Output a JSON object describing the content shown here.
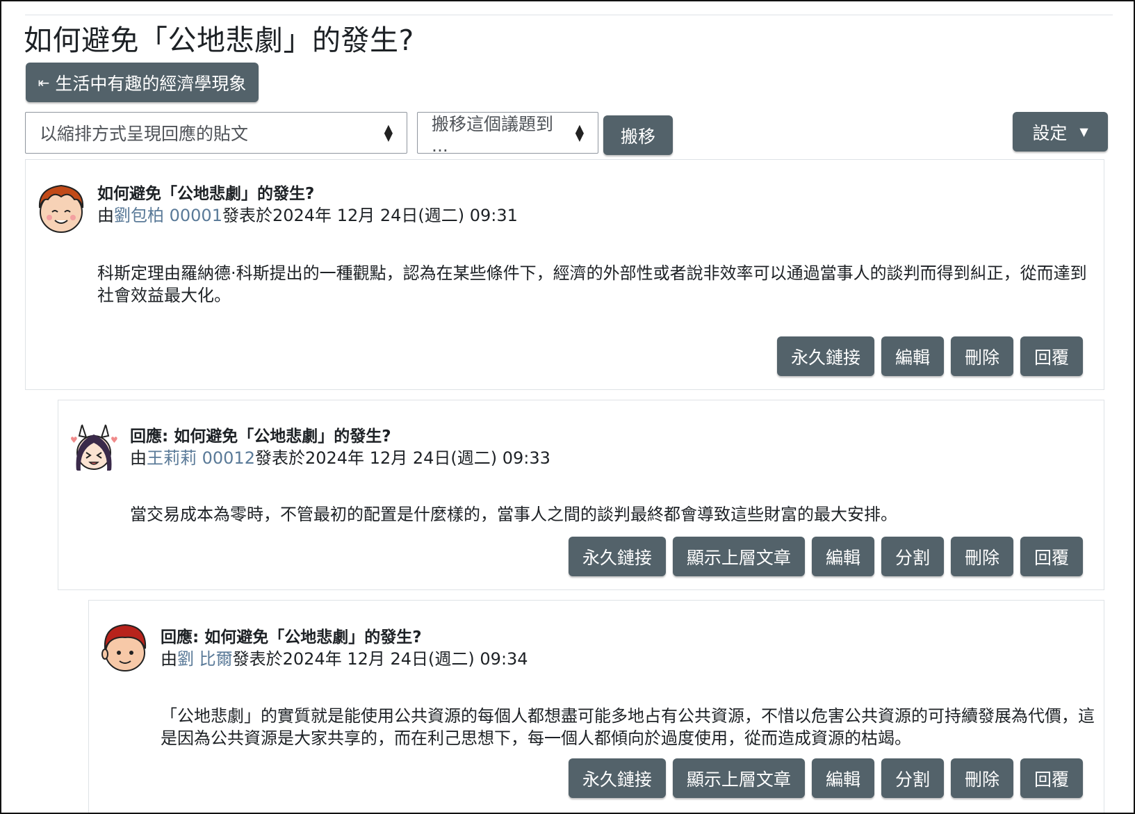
{
  "page": {
    "title": "如何避免「公地悲劇」的發生?",
    "back_link": "生活中有趣的經濟學現象",
    "display_mode": "以縮排方式呈現回應的貼文",
    "move_select": "搬移這個議題到 ...",
    "move_button": "搬移",
    "settings_button": "設定"
  },
  "posts": [
    {
      "subject": "如何避免「公地悲劇」的發生?",
      "by": "由",
      "author": "劉包柏 00001",
      "posted": "發表於2024年 12月 24日(週二) 09:31",
      "body": "科斯定理由羅納德·科斯提出的一種觀點，認為在某些條件下，經濟的外部性或者說非效率可以通過當事人的談判而得到糾正，從而達到社會效益最大化。",
      "actions": [
        "永久鏈接",
        "編輯",
        "刪除",
        "回覆"
      ]
    },
    {
      "subject": "回應: 如何避免「公地悲劇」的發生?",
      "by": "由",
      "author": "王莉莉 00012",
      "posted": "發表於2024年 12月 24日(週二) 09:33",
      "body": "當交易成本為零時，不管最初的配置是什麼樣的，當事人之間的談判最終都會導致這些財富的最大安排。",
      "actions": [
        "永久鏈接",
        "顯示上層文章",
        "編輯",
        "分割",
        "刪除",
        "回覆"
      ]
    },
    {
      "subject": "回應: 如何避免「公地悲劇」的發生?",
      "by": "由",
      "author": "劉 比爾",
      "posted": "發表於2024年 12月 24日(週二) 09:34",
      "body": "「公地悲劇」的實質就是能使用公共資源的每個人都想盡可能多地占有公共資源，不惜以危害公共資源的可持續發展為代價，這是因為公共資源是大家共享的，而在利己思想下，每一個人都傾向於過度使用，從而造成資源的枯竭。",
      "actions": [
        "永久鏈接",
        "顯示上層文章",
        "編輯",
        "分割",
        "刪除",
        "回覆"
      ]
    }
  ]
}
